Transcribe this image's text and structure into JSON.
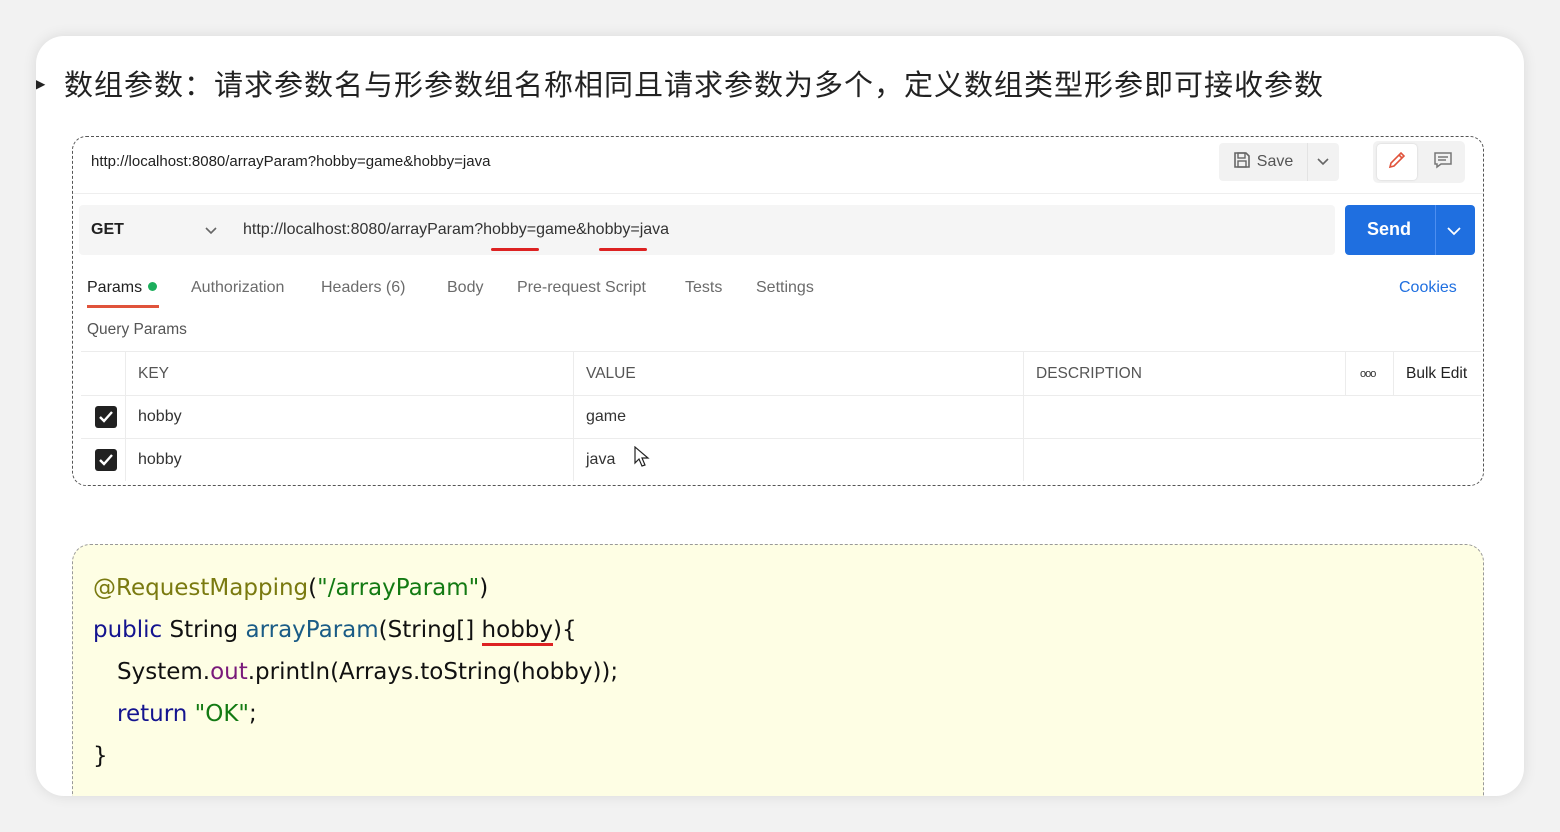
{
  "heading": "数组参数：请求参数名与形参数组名称相同且请求参数为多个，定义数组类型形参即可接收参数",
  "postman": {
    "tab_title": "http://localhost:8080/arrayParam?hobby=game&hobby=java",
    "save_label": "Save",
    "method": "GET",
    "url": "http://localhost:8080/arrayParam?hobby=game&hobby=java",
    "send_label": "Send",
    "tabs": {
      "params": "Params",
      "authorization": "Authorization",
      "headers": "Headers (6)",
      "body": "Body",
      "pre_request": "Pre-request Script",
      "tests": "Tests",
      "settings": "Settings"
    },
    "cookies_label": "Cookies",
    "query_params_label": "Query Params",
    "table": {
      "headers": {
        "key": "KEY",
        "value": "VALUE",
        "description": "DESCRIPTION",
        "more": "ooo",
        "bulk_edit": "Bulk Edit"
      },
      "rows": [
        {
          "key": "hobby",
          "value": "game",
          "description": ""
        },
        {
          "key": "hobby",
          "value": "java",
          "description": ""
        }
      ]
    },
    "colors": {
      "send": "#1f6fe0",
      "active_tab_underline": "#e0533b",
      "params_dot": "#1cae5c"
    }
  },
  "code": {
    "l1_anno": "@RequestMapping",
    "l1_open": "(",
    "l1_str": "\"/arrayParam\"",
    "l1_close": ")",
    "l2_kw": "public",
    "l2_type": " String ",
    "l2_fn": "arrayParam",
    "l2_args_a": "(String[] ",
    "l2_param": "hobby",
    "l2_args_b": "){",
    "l3_a": "System.",
    "l3_field": "out",
    "l3_b": ".println(Arrays.toString(hobby));",
    "l4_kw": "return",
    "l4_str": " \"OK\"",
    "l4_end": ";",
    "l5": "}"
  }
}
